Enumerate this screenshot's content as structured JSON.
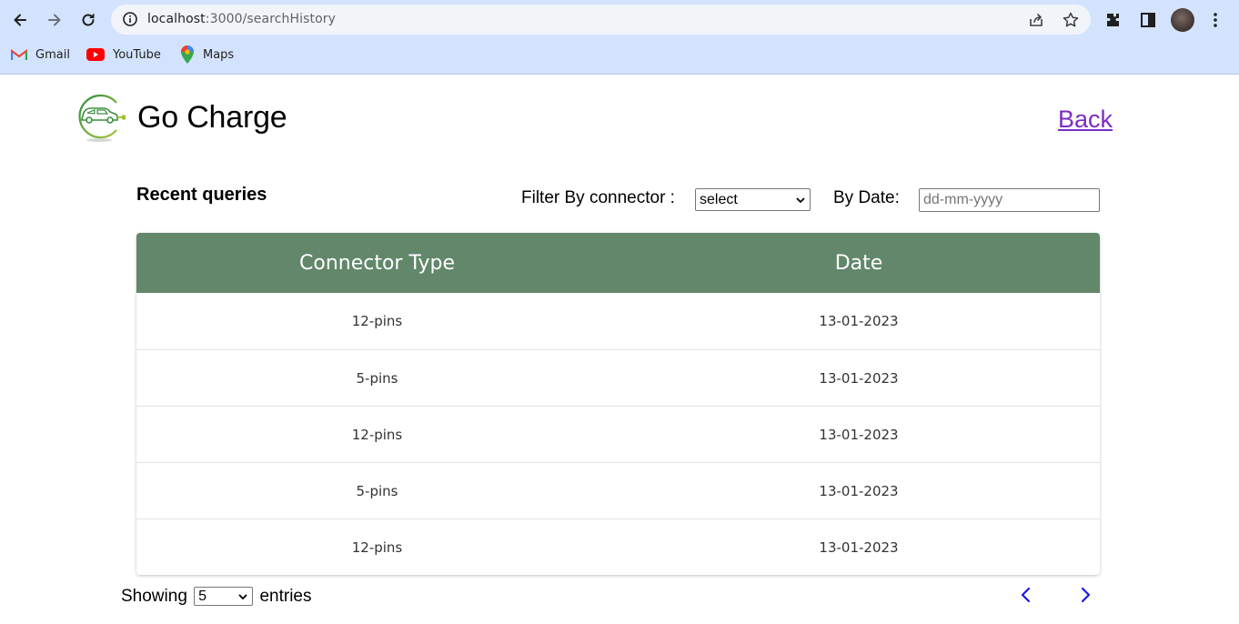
{
  "browser": {
    "url_host": "localhost",
    "url_path": ":3000/searchHistory",
    "bookmarks": [
      {
        "label": "Gmail",
        "icon": "gmail-icon"
      },
      {
        "label": "YouTube",
        "icon": "youtube-icon"
      },
      {
        "label": "Maps",
        "icon": "maps-icon"
      }
    ]
  },
  "header": {
    "brand": "Go Charge",
    "back_label": "Back"
  },
  "filters": {
    "section_title": "Recent queries",
    "connector_label": "Filter By connector :",
    "connector_value": "select",
    "date_label": "By Date:",
    "date_placeholder": "dd-mm-yyyy"
  },
  "table": {
    "columns": [
      "Connector Type",
      "Date"
    ],
    "rows": [
      [
        "12-pins",
        "13-01-2023"
      ],
      [
        "5-pins",
        "13-01-2023"
      ],
      [
        "12-pins",
        "13-01-2023"
      ],
      [
        "5-pins",
        "13-01-2023"
      ],
      [
        "12-pins",
        "13-01-2023"
      ]
    ]
  },
  "footer": {
    "showing_label": "Showing",
    "entries_value": "5",
    "entries_label": "entries"
  },
  "colors": {
    "table_header": "#62876b",
    "link": "#7b2ec5",
    "pager": "#1a1ae6",
    "chrome": "#d3e3fd"
  }
}
